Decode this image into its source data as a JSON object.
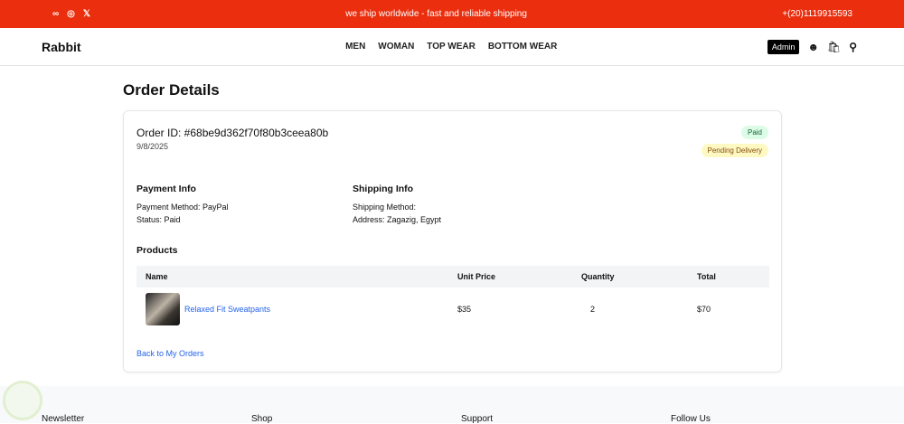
{
  "topbar": {
    "social": [
      "meta-icon",
      "instagram-icon",
      "x-icon"
    ],
    "message": "we ship worldwide - fast and reliable shipping",
    "phone": "+(20)1119915593",
    "color": "#ea2e0e"
  },
  "nav": {
    "logo": "Rabbit",
    "menu": [
      "MEN",
      "WOMAN",
      "TOP WEAR",
      "BOTTOM WEAR"
    ],
    "admin": "Admin"
  },
  "page_title": "Order Details",
  "order": {
    "id": "Order ID: #68be9d362f70f80b3ceea80b",
    "date": "9/8/2025",
    "badges": {
      "paid": "Paid",
      "delivery": "Pending Delivery"
    },
    "payment": {
      "title": "Payment Info",
      "method": "Payment Method: PayPal",
      "status": "Status: Paid"
    },
    "shipping": {
      "title": "Shipping Info",
      "method": "Shipping Method:",
      "address": "Address: Zagazig, Egypt"
    },
    "products_title": "Products",
    "columns": [
      "Name",
      "Unit Price",
      "Quantity",
      "Total"
    ],
    "items": [
      {
        "name": "Relaxed Fit Sweatpants",
        "price": "$35",
        "qty": "2",
        "total": "$70"
      }
    ],
    "back": "Back to My Orders"
  },
  "footer": {
    "columns": [
      "Newsletter",
      "Shop",
      "Support",
      "Follow Us"
    ]
  }
}
